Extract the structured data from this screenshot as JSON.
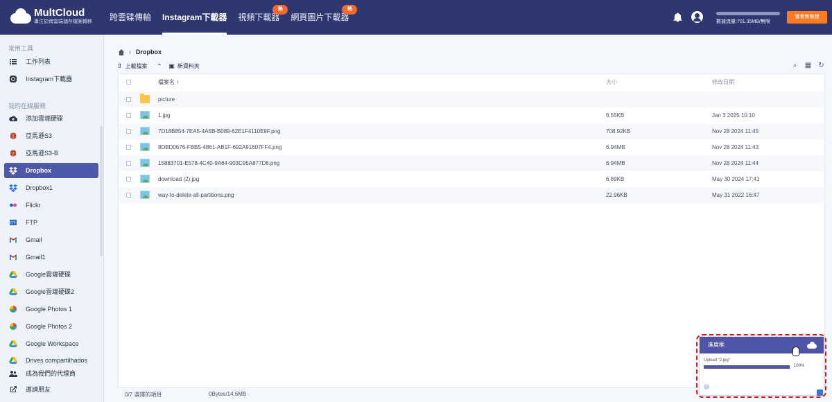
{
  "brand": {
    "name": "MultCloud",
    "tagline": "專注於跨雲端儲存檔案轉移"
  },
  "nav": {
    "items": [
      {
        "label": "跨雲碟傳輸",
        "active": false,
        "badge": ""
      },
      {
        "label": "Instagram下載器",
        "active": true,
        "badge": ""
      },
      {
        "label": "視頻下載器",
        "active": false,
        "badge": "熱"
      },
      {
        "label": "網頁圖片下載器",
        "active": false,
        "badge": "熱"
      }
    ]
  },
  "topbar": {
    "traffic": "數據流量:701.35MB/無限",
    "upgrade": "獲會無限版"
  },
  "sidebar": {
    "section_tools": "常用工具",
    "tools": [
      {
        "label": "工作列表",
        "icon": "list-icon"
      },
      {
        "label": "Instagram下載器",
        "icon": "instagram-icon"
      }
    ],
    "section_clouds": "我的在線服務",
    "clouds": [
      {
        "label": "添加雲端硬碟",
        "icon": "cloud-add-icon",
        "active": false
      },
      {
        "label": "亞馬遜S3",
        "icon": "amazon-s3-icon",
        "active": false
      },
      {
        "label": "亞馬遜S3-B",
        "icon": "amazon-s3-icon",
        "active": false
      },
      {
        "label": "Dropbox",
        "icon": "dropbox-icon",
        "active": true
      },
      {
        "label": "Dropbox1",
        "icon": "dropbox-icon",
        "active": false
      },
      {
        "label": "Flickr",
        "icon": "flickr-icon",
        "active": false
      },
      {
        "label": "FTP",
        "icon": "ftp-icon",
        "active": false
      },
      {
        "label": "Gmail",
        "icon": "gmail-icon",
        "active": false
      },
      {
        "label": "Gmail1",
        "icon": "gmail-icon",
        "active": false
      },
      {
        "label": "Google雲端硬碟",
        "icon": "google-drive-icon",
        "active": false
      },
      {
        "label": "Google雲端硬碟2",
        "icon": "google-drive-icon",
        "active": false
      },
      {
        "label": "Google Photos 1",
        "icon": "google-photos-icon",
        "active": false
      },
      {
        "label": "Google Photos 2",
        "icon": "google-photos-icon",
        "active": false
      },
      {
        "label": "Google Workspace",
        "icon": "google-drive-icon",
        "active": false
      },
      {
        "label": "Drives compartilhados",
        "icon": "google-drive-icon",
        "active": false
      }
    ],
    "agent": "成為我們的代理商",
    "invite": "邀請朋友"
  },
  "breadcrumb": {
    "current": "Dropbox"
  },
  "toolbar": {
    "upload": "上載檔案",
    "new_folder": "新資料夾"
  },
  "table": {
    "headers": {
      "name": "檔案名",
      "size": "大小",
      "date": "修改日期"
    },
    "rows": [
      {
        "name": "picture",
        "size": "",
        "date": "",
        "type": "folder"
      },
      {
        "name": "1.jpg",
        "size": "6.55KB",
        "date": "Jan 3 2025 10:10",
        "type": "image"
      },
      {
        "name": "7D18B854-7EA5-4A5B-B089-62E1F4110E9F.png",
        "size": "708.92KB",
        "date": "Nov 28 2024 11:45",
        "type": "image"
      },
      {
        "name": "8DBD0676-FBB5-4861-AB1F-692A91607FF4.png",
        "size": "6.94MB",
        "date": "Nov 28 2024 11:43",
        "type": "image"
      },
      {
        "name": "15883701-E578-4C40-9A64-903C95A877D6.png",
        "size": "6.94MB",
        "date": "Nov 28 2024 11:44",
        "type": "image"
      },
      {
        "name": "download (2).jpg",
        "size": "6.89KB",
        "date": "May 30 2024 17:41",
        "type": "image"
      },
      {
        "name": "way-to-delete-all-partitions.png",
        "size": "22.96KB",
        "date": "May 31 2022 16:47",
        "type": "image"
      }
    ]
  },
  "footer": {
    "selected": "0/7 選擇的項目",
    "storage": "0Bytes/14.6MB"
  },
  "progress_box": {
    "title": "進度框",
    "upload": "Upload \"2.jpg\"",
    "percent": "100%",
    "value": 1
  }
}
